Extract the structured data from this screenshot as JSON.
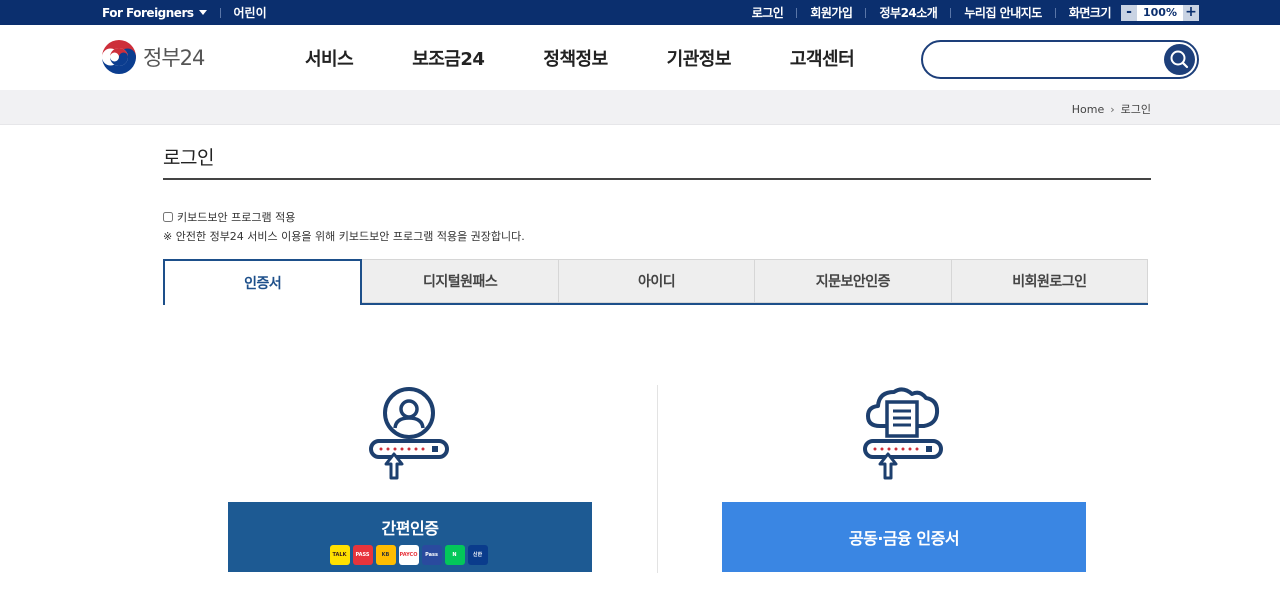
{
  "topbar": {
    "foreigners": "For Foreigners",
    "kids": "어린이",
    "links": [
      "로그인",
      "회원가입",
      "정부24소개",
      "누리집 안내지도",
      "화면크기"
    ],
    "zoom_minus": "-",
    "zoom_value": "100%",
    "zoom_plus": "+"
  },
  "header": {
    "brand": "정부24",
    "menu": [
      "서비스",
      "보조금24",
      "정책정보",
      "기관정보",
      "고객센터"
    ],
    "search": {
      "value": "",
      "placeholder": ""
    }
  },
  "breadcrumb": {
    "home": "Home",
    "current": "로그인"
  },
  "page": {
    "title": "로그인",
    "keyboard_security_label": "키보드보안 프로그램 적용",
    "keyboard_security_checked": false,
    "notice": "※ 안전한 정부24 서비스 이용을 위해 키보드보안 프로그램 적용을 권장합니다."
  },
  "tabs": [
    {
      "label": "인증서",
      "active": true
    },
    {
      "label": "디지털원패스",
      "active": false
    },
    {
      "label": "아이디",
      "active": false
    },
    {
      "label": "지문보안인증",
      "active": false
    },
    {
      "label": "비회원로그인",
      "active": false
    }
  ],
  "options": {
    "simple_auth": {
      "label": "간편인증",
      "icon": "user-login-icon",
      "providers": [
        {
          "name": "TALK",
          "bg": "#ffe000",
          "fg": "#3a1d1d"
        },
        {
          "name": "PASS",
          "bg": "#e8343c",
          "fg": "#ffffff"
        },
        {
          "name": "KB",
          "bg": "#ffbc00",
          "fg": "#333333"
        },
        {
          "name": "PAYCO",
          "bg": "#ffffff",
          "fg": "#e8343c"
        },
        {
          "name": "Pass",
          "bg": "#2a4a9e",
          "fg": "#ffffff"
        },
        {
          "name": "N",
          "bg": "#03c75a",
          "fg": "#ffffff"
        },
        {
          "name": "신한",
          "bg": "#0a3c8c",
          "fg": "#ffffff"
        }
      ]
    },
    "joint_cert": {
      "label": "공동·금융 인증서",
      "icon": "cloud-certificate-icon"
    }
  },
  "colors": {
    "topbar": "#0b2f6e",
    "accent": "#1d4f8a",
    "simple_auth_button": "#1d5a93",
    "joint_cert_button": "#3a86e3"
  }
}
